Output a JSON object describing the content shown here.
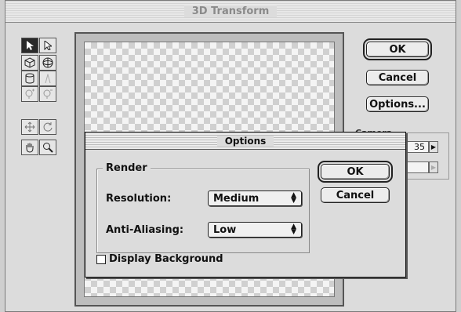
{
  "window": {
    "title": "3D Transform"
  },
  "toolbar": {
    "tools": [
      {
        "name": "selection-tool-icon",
        "glyph": "▶"
      },
      {
        "name": "direct-selection-tool-icon",
        "glyph": "▷"
      },
      {
        "name": "cube-tool-icon",
        "glyph": "⬡"
      },
      {
        "name": "sphere-tool-icon",
        "glyph": "⊕"
      },
      {
        "name": "cylinder-tool-icon",
        "glyph": "⌸"
      },
      {
        "name": "convert-anchor-point-tool-icon",
        "glyph": "⅄"
      },
      {
        "name": "add-anchor-point-tool-icon",
        "glyph": "✦"
      },
      {
        "name": "delete-anchor-point-tool-icon",
        "glyph": "✧"
      },
      {
        "name": "pan-camera-tool-icon",
        "glyph": "✥"
      },
      {
        "name": "trackball-tool-icon",
        "glyph": "↻"
      },
      {
        "name": "hand-tool-icon",
        "glyph": "✋"
      },
      {
        "name": "zoom-tool-icon",
        "glyph": "🔍"
      }
    ]
  },
  "buttons": {
    "ok": "OK",
    "cancel": "Cancel",
    "options": "Options..."
  },
  "camera": {
    "label": "Camera",
    "field_of_view": "35"
  },
  "dialog": {
    "title": "Options",
    "render_group": "Render",
    "resolution_label": "Resolution:",
    "resolution_value": "Medium",
    "antialias_label": "Anti-Aliasing:",
    "antialias_value": "Low",
    "display_background_label": "Display Background",
    "display_background_checked": false,
    "ok": "OK",
    "cancel": "Cancel"
  }
}
